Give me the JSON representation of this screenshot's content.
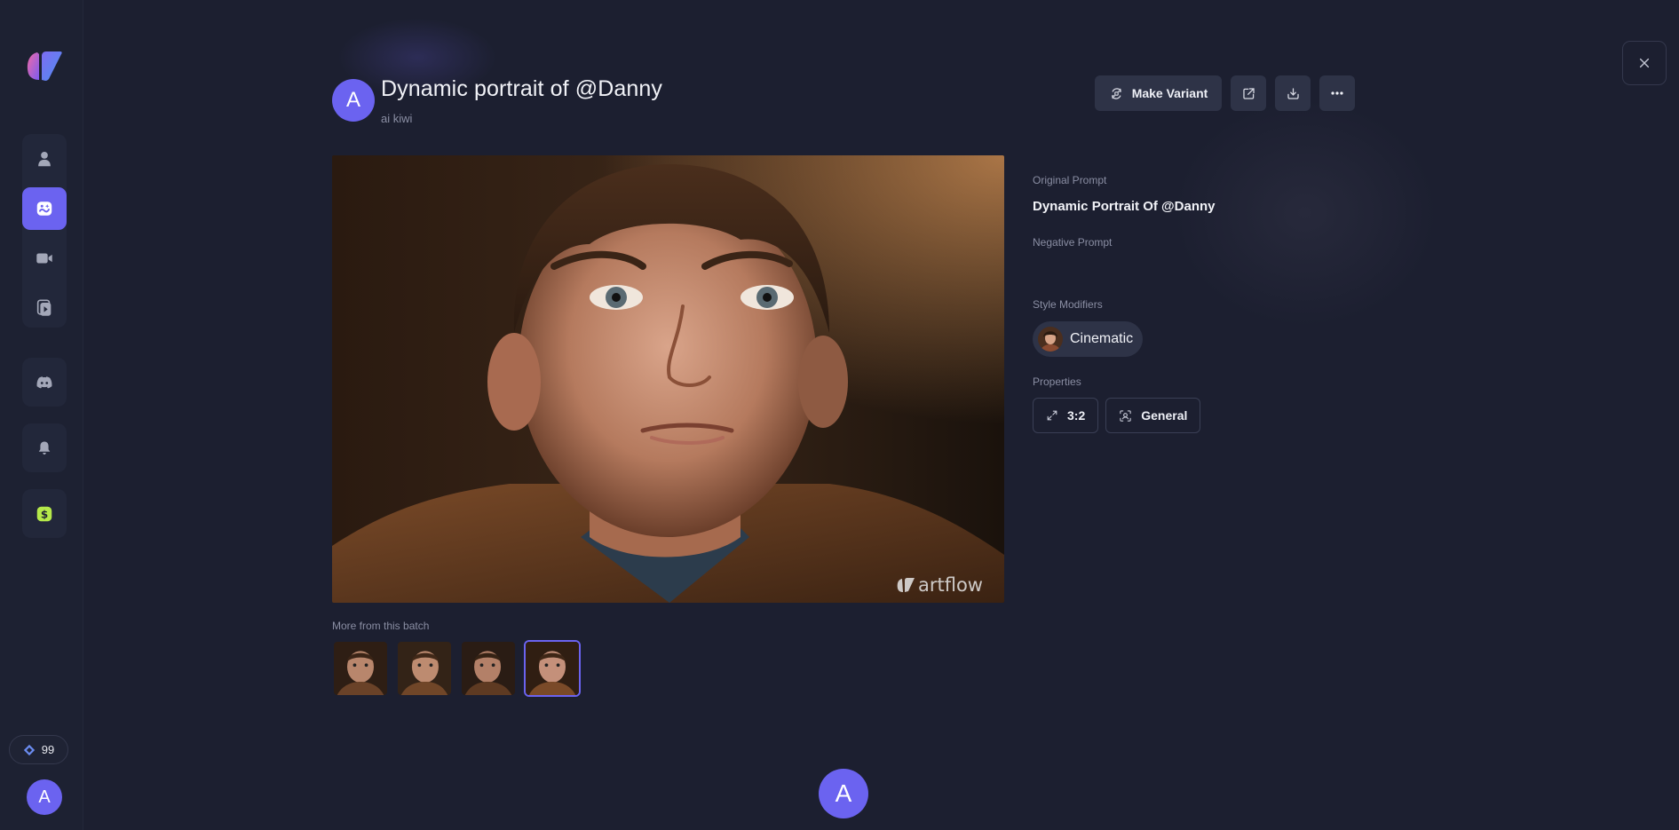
{
  "sidebar": {
    "logo": "artflow-logo",
    "nav_top": [
      "characters",
      "create-image",
      "video",
      "clips"
    ],
    "active_nav": "create-image",
    "credits": "99"
  },
  "user": {
    "initial": "A"
  },
  "image": {
    "title": "Dynamic portrait of @Danny",
    "author": "ai kiwi",
    "watermark": "artflow",
    "batch_label": "More from this batch",
    "thumbnail_count": 4,
    "selected_thumbnail": 4
  },
  "toolbar": {
    "make_variant_label": "Make Variant",
    "icons": [
      "external-link-icon",
      "download-icon",
      "more-icon"
    ]
  },
  "details": {
    "original_prompt_label": "Original Prompt",
    "original_prompt": "Dynamic Portrait Of @Danny",
    "negative_prompt_label": "Negative Prompt",
    "negative_prompt": "",
    "style_modifiers_label": "Style Modifiers",
    "style_modifier": "Cinematic",
    "properties_label": "Properties",
    "aspect_ratio": "3:2",
    "model": "General"
  },
  "colors": {
    "accent": "#6b63f0",
    "background": "#1c1f30",
    "panel": "#22273a"
  }
}
